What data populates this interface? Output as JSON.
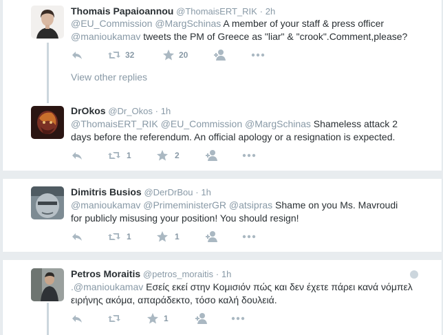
{
  "tweets": [
    {
      "name": "Thomais Papaioannou",
      "handle": "@ThomaisERT_RIK",
      "time": "2h",
      "body_mentions": "@EU_Commission @MargSchinas",
      "body_text": " A member of your staff & press officer",
      "body_line2_mention": "@manioukamav",
      "body_line2_text": " tweets the PM of Greece as \"liar\" & \"crook\".Comment,please?",
      "retweets": "32",
      "likes": "20",
      "view_replies": "View other replies"
    },
    {
      "name": "DrOkos",
      "handle": "@Dr_Okos",
      "time": "1h",
      "body_mentions": "@ThomaisERT_RIK @EU_Commission @MargSchinas",
      "body_text": " Shameless attack 2",
      "body_line2_text": "days before the referendum. An official apology or a resignation is expected.",
      "retweets": "1",
      "likes": "2"
    },
    {
      "name": "Dimitris Busios",
      "handle": "@DerDrBou",
      "time": "1h",
      "body_mentions": "@manioukamav @PrimeministerGR @atsipras",
      "body_text": " Shame on you Ms. Mavroudi",
      "body_line2_text": "for publicly misusing your position! You should resign!",
      "retweets": "1",
      "likes": "1"
    },
    {
      "name": "Petros Moraitis",
      "handle": "@petros_moraitis",
      "time": "1h",
      "body_prefix": ".",
      "body_mentions": "@manioukamav",
      "body_text": " Εσείς εκεί στην Κομισιόν πώς και δεν έχετε πάρει κανά νόμπελ",
      "body_line2_text": "ειρήνης ακόμα, απαράδεκτο, τόσο καλή δουλειά.",
      "likes": "1"
    }
  ],
  "icons": {
    "reply": "reply-icon",
    "retweet": "retweet-icon",
    "like": "star-icon",
    "follow": "follow-icon",
    "more": "more-dots-icon"
  },
  "colors": {
    "name": "#292f33",
    "muted": "#8899a6",
    "icon": "#aab8c2",
    "thread_line": "#ccd6dd"
  },
  "separator": "·"
}
